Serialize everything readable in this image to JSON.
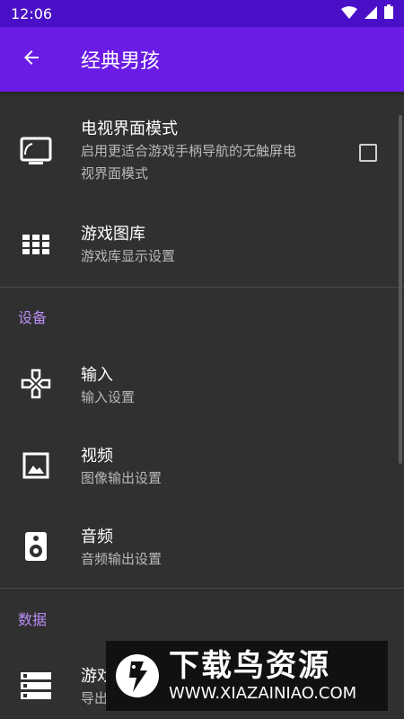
{
  "status_bar": {
    "time": "12:06"
  },
  "app_bar": {
    "title": "经典男孩"
  },
  "items": [
    {
      "title": "电视界面模式",
      "summary_line1": "启用更适合游戏手柄导航的无触屏电",
      "summary_line2": "视界面模式",
      "checked": false
    },
    {
      "title": "游戏图库",
      "summary": "游戏库显示设置"
    },
    {
      "title": "输入",
      "summary": "输入设置"
    },
    {
      "title": "视频",
      "summary": "图像输出设置"
    },
    {
      "title": "音频",
      "summary": "音频输出设置"
    },
    {
      "title": "游戏",
      "summary": "导出"
    }
  ],
  "categories": {
    "devices": "设备",
    "data": "数据"
  },
  "watermark": {
    "title": "下载鸟资源",
    "url": "WWW.XIAZAINIAO.COM"
  },
  "colors": {
    "status_bar": "#4a10c7",
    "app_bar": "#6a1be6",
    "background": "#303030",
    "category": "#b98cf5"
  }
}
